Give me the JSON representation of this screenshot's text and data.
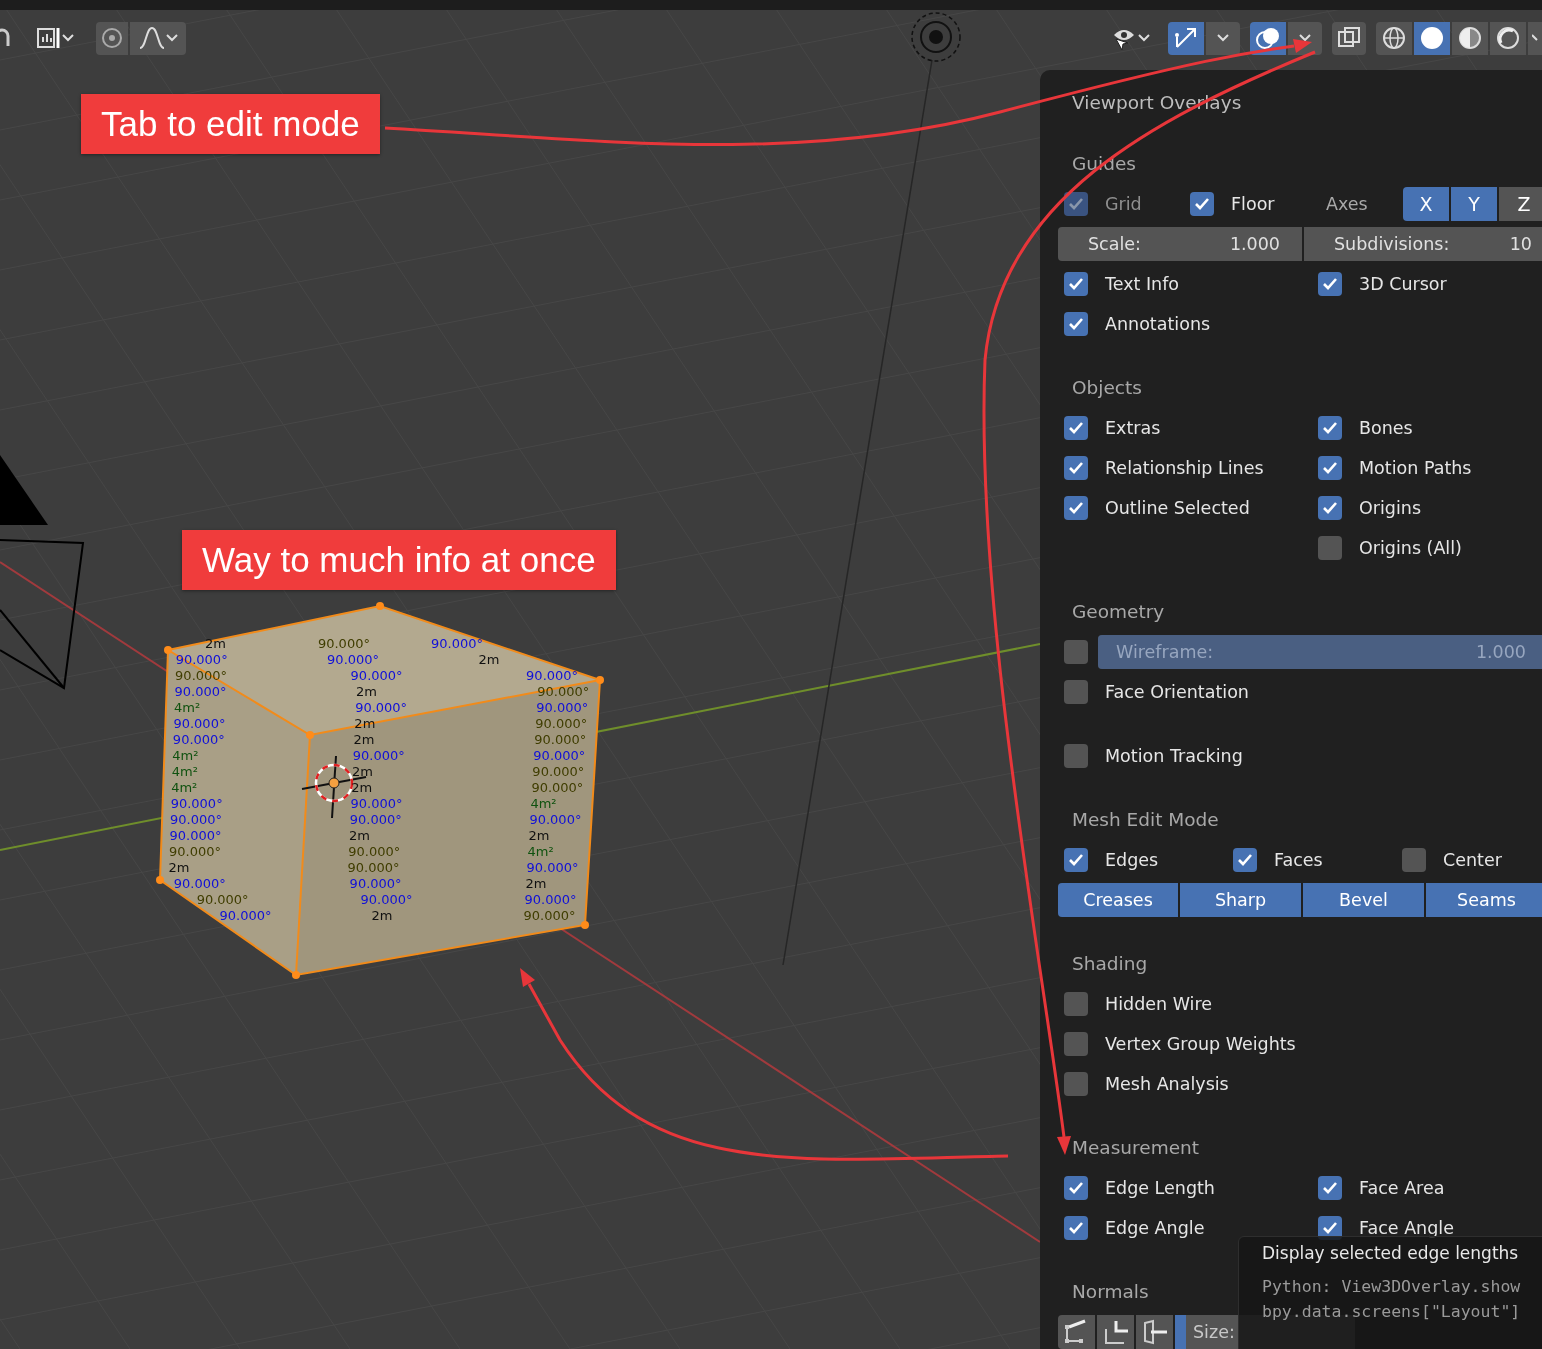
{
  "header": {
    "gizmos": {
      "on": true
    },
    "overlays": {
      "on": true
    },
    "xray": {
      "on": false
    },
    "shading_modes": [
      {
        "kind": "wireframe",
        "selected": false
      },
      {
        "kind": "solid",
        "selected": true
      },
      {
        "kind": "material",
        "selected": false
      },
      {
        "kind": "rendered",
        "selected": false
      }
    ]
  },
  "annotations": [
    {
      "text": "Tab to edit mode"
    },
    {
      "text": "Way to much info at once"
    }
  ],
  "measurements": [
    {
      "kind": "edge-length",
      "text": "2m"
    },
    {
      "kind": "edge-angle",
      "text": "90.000°"
    },
    {
      "kind": "face-angle",
      "text": "90.000°"
    },
    {
      "kind": "face-angle",
      "text": "90.000°"
    },
    {
      "kind": "face-angle",
      "text": "90.000°"
    },
    {
      "kind": "edge-length",
      "text": "2m"
    },
    {
      "kind": "edge-angle",
      "text": "90.000°"
    },
    {
      "kind": "face-angle",
      "text": "90.000°"
    },
    {
      "kind": "face-angle",
      "text": "90.000°"
    },
    {
      "kind": "face-angle",
      "text": "90.000°"
    },
    {
      "kind": "edge-length",
      "text": "2m"
    },
    {
      "kind": "edge-angle",
      "text": "90.000°"
    },
    {
      "kind": "face-area",
      "text": "4m²"
    },
    {
      "kind": "face-angle",
      "text": "90.000°"
    },
    {
      "kind": "face-angle",
      "text": "90.000°"
    },
    {
      "kind": "face-angle",
      "text": "90.000°"
    },
    {
      "kind": "edge-length",
      "text": "2m"
    },
    {
      "kind": "edge-angle",
      "text": "90.000°"
    },
    {
      "kind": "face-angle",
      "text": "90.000°"
    },
    {
      "kind": "edge-length",
      "text": "2m"
    },
    {
      "kind": "edge-angle",
      "text": "90.000°"
    },
    {
      "kind": "face-area",
      "text": "4m²"
    },
    {
      "kind": "face-angle",
      "text": "90.000°"
    },
    {
      "kind": "face-angle",
      "text": "90.000°"
    },
    {
      "kind": "face-area",
      "text": "4m²"
    },
    {
      "kind": "edge-length",
      "text": "2m"
    },
    {
      "kind": "edge-angle",
      "text": "90.000°"
    },
    {
      "kind": "face-area",
      "text": "4m²"
    },
    {
      "kind": "edge-length",
      "text": "2m"
    },
    {
      "kind": "edge-angle",
      "text": "90.000°"
    },
    {
      "kind": "face-angle",
      "text": "90.000°"
    },
    {
      "kind": "face-angle",
      "text": "90.000°"
    },
    {
      "kind": "face-area",
      "text": "4m²"
    },
    {
      "kind": "face-angle",
      "text": "90.000°"
    },
    {
      "kind": "face-angle",
      "text": "90.000°"
    },
    {
      "kind": "face-angle",
      "text": "90.000°"
    },
    {
      "kind": "face-angle",
      "text": "90.000°"
    },
    {
      "kind": "edge-length",
      "text": "2m"
    },
    {
      "kind": "edge-length",
      "text": "2m"
    },
    {
      "kind": "edge-angle",
      "text": "90.000°"
    },
    {
      "kind": "edge-angle",
      "text": "90.000°"
    },
    {
      "kind": "face-area",
      "text": "4m²"
    },
    {
      "kind": "edge-length",
      "text": "2m"
    },
    {
      "kind": "edge-angle",
      "text": "90.000°"
    },
    {
      "kind": "face-angle",
      "text": "90.000°"
    },
    {
      "kind": "face-angle",
      "text": "90.000°"
    },
    {
      "kind": "face-angle",
      "text": "90.000°"
    },
    {
      "kind": "edge-length",
      "text": "2m"
    },
    {
      "kind": "edge-angle",
      "text": "90.000°"
    },
    {
      "kind": "face-angle",
      "text": "90.000°"
    },
    {
      "kind": "face-angle",
      "text": "90.000°"
    },
    {
      "kind": "face-angle",
      "text": "90.000°"
    },
    {
      "kind": "edge-length",
      "text": "2m"
    },
    {
      "kind": "edge-angle",
      "text": "90.000°"
    }
  ],
  "overlays": {
    "title": "Viewport Overlays",
    "sections": [
      {
        "heading": "Guides",
        "rows": [
          {
            "kind": "guides",
            "checks": [
              {
                "label": "Grid",
                "checked": true,
                "disabled": true
              },
              {
                "label": "Floor",
                "checked": true,
                "disabled": false
              }
            ],
            "axes_label": "Axes",
            "axes": [
              {
                "label": "X",
                "selected": true
              },
              {
                "label": "Y",
                "selected": true
              },
              {
                "label": "Z",
                "selected": false
              }
            ]
          },
          {
            "kind": "fields",
            "fields": [
              {
                "label": "Scale:",
                "value": "1.000"
              },
              {
                "label": "Subdivisions:",
                "value": "10"
              }
            ]
          },
          {
            "kind": "pair",
            "checks": [
              {
                "label": "Text Info",
                "checked": true
              },
              {
                "label": "3D Cursor",
                "checked": true
              }
            ]
          },
          {
            "kind": "pair",
            "checks": [
              {
                "label": "Annotations",
                "checked": true
              }
            ]
          }
        ]
      },
      {
        "heading": "Objects",
        "rows": [
          {
            "kind": "pair",
            "checks": [
              {
                "label": "Extras",
                "checked": true
              },
              {
                "label": "Bones",
                "checked": true
              }
            ]
          },
          {
            "kind": "pair",
            "checks": [
              {
                "label": "Relationship Lines",
                "checked": true
              },
              {
                "label": "Motion Paths",
                "checked": true
              }
            ]
          },
          {
            "kind": "pair",
            "checks": [
              {
                "label": "Outline Selected",
                "checked": true
              },
              {
                "label": "Origins",
                "checked": true
              }
            ]
          },
          {
            "kind": "pair-right",
            "checks": [
              {
                "label": "Origins (All)",
                "checked": false
              }
            ]
          }
        ]
      },
      {
        "heading": "Geometry",
        "rows": [
          {
            "kind": "slider",
            "check": {
              "checked": false
            },
            "label": "Wireframe:",
            "value": "1.000",
            "level": 1,
            "disabled": true
          },
          {
            "kind": "pair",
            "checks": [
              {
                "label": "Face Orientation",
                "checked": false
              }
            ]
          },
          {
            "kind": "subpanel",
            "checks": [
              {
                "label": "Motion Tracking",
                "checked": false
              }
            ]
          }
        ]
      },
      {
        "heading": "Mesh Edit Mode",
        "rows": [
          {
            "kind": "triple",
            "checks": [
              {
                "label": "Edges",
                "checked": true
              },
              {
                "label": "Faces",
                "checked": true
              },
              {
                "label": "Center",
                "checked": false
              }
            ]
          },
          {
            "kind": "buttons",
            "buttons": [
              {
                "label": "Creases",
                "selected": true
              },
              {
                "label": "Sharp",
                "selected": true
              },
              {
                "label": "Bevel",
                "selected": true
              },
              {
                "label": "Seams",
                "selected": true
              }
            ]
          }
        ]
      },
      {
        "heading": "Shading",
        "rows": [
          {
            "kind": "pair",
            "checks": [
              {
                "label": "Hidden Wire",
                "checked": false
              }
            ]
          },
          {
            "kind": "pair",
            "checks": [
              {
                "label": "Vertex Group Weights",
                "checked": false
              }
            ]
          },
          {
            "kind": "pair",
            "checks": [
              {
                "label": "Mesh Analysis",
                "checked": false
              }
            ]
          }
        ]
      },
      {
        "heading": "Measurement",
        "rows": [
          {
            "kind": "pair",
            "checks": [
              {
                "label": "Edge Length",
                "checked": true
              },
              {
                "label": "Face Area",
                "checked": true
              }
            ]
          },
          {
            "kind": "pair",
            "checks": [
              {
                "label": "Edge Angle",
                "checked": true
              },
              {
                "label": "Face Angle",
                "checked": true
              }
            ]
          }
        ]
      },
      {
        "heading": "Normals",
        "rows": [
          {
            "kind": "normals",
            "size_label": "Size:",
            "level": 0.06
          }
        ]
      }
    ]
  },
  "tooltip": {
    "text": "Display selected edge lengths",
    "python": [
      "Python: View3DOverlay.show",
      "bpy.data.screens[\"Layout\"]"
    ]
  }
}
